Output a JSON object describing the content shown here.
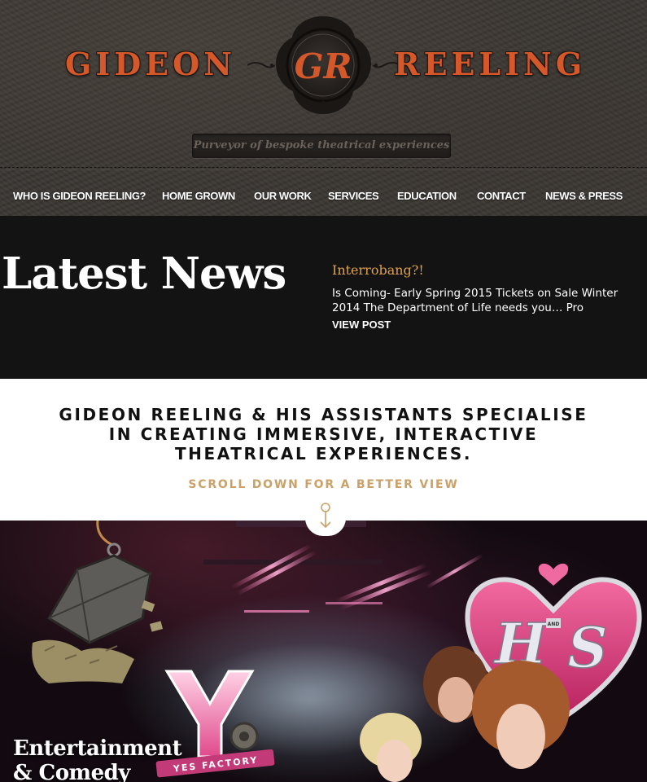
{
  "header": {
    "brand_left": "GIDEON",
    "brand_right": "REELING",
    "monogram": "GR",
    "tagline": "Purveyor of bespoke theatrical experiences"
  },
  "nav": {
    "items": [
      {
        "label": "WHO IS GIDEON REELING?"
      },
      {
        "label": "HOME GROWN"
      },
      {
        "label": "OUR WORK"
      },
      {
        "label": "SERVICES"
      },
      {
        "label": "EDUCATION"
      },
      {
        "label": "CONTACT"
      },
      {
        "label": "NEWS & PRESS"
      }
    ]
  },
  "news": {
    "heading": "Latest News",
    "post_title": "Interrobang?!",
    "excerpt": "Is Coming- Early Spring 2015 Tickets on Sale Winter 2014 The Department of Life needs you… Pro",
    "link_label": "VIEW POST"
  },
  "intro": {
    "line1": "GIDEON REELING & HIS ASSISTANTS SPECIALISE",
    "line2": "IN CREATING IMMERSIVE, INTERACTIVE",
    "line3": "THEATRICAL EXPERIENCES.",
    "scroll_label": "SCROLL DOWN FOR A BETTER VIEW"
  },
  "hero": {
    "caption_line1": "Entertainment",
    "caption_line2": "& Comedy",
    "yes_factory_label": "YES FACTORY",
    "heart_small_text": "AND"
  },
  "colors": {
    "brand_orange": "#d5582b",
    "header_bg": "#3b3733",
    "news_bg": "#141314",
    "post_title": "#e0a24a",
    "scroll_gold": "#c9a169"
  }
}
